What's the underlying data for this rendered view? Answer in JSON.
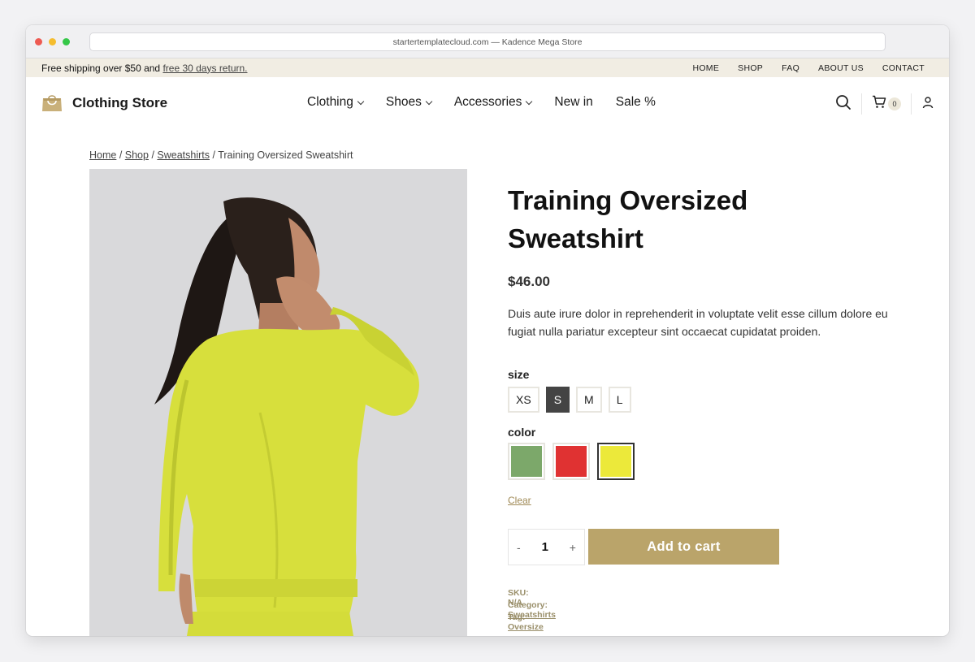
{
  "browser": {
    "url": "startertemplatecloud.com — Kadence Mega Store"
  },
  "topbar": {
    "shipping_text": "Free shipping over $50 and ",
    "shipping_link": "free 30 days return.",
    "nav": [
      "HOME",
      "SHOP",
      "FAQ",
      "ABOUT US",
      "CONTACT"
    ]
  },
  "header": {
    "brand": "Clothing Store",
    "nav": [
      "Clothing",
      "Shoes",
      "Accessories",
      "New in",
      "Sale %"
    ],
    "cart_count": "0"
  },
  "breadcrumb": {
    "home": "Home",
    "shop": "Shop",
    "category": "Sweatshirts",
    "current": "Training Oversized Sweatshirt",
    "sep": " / "
  },
  "product": {
    "title": "Training Oversized Sweatshirt",
    "price": "$46.00",
    "description": "Duis aute irure dolor in reprehenderit in voluptate velit esse cillum dolore eu fugiat nulla pariatur excepteur sint occaecat cupidatat proiden.",
    "size_label": "size",
    "sizes": [
      "XS",
      "S",
      "M",
      "L"
    ],
    "selected_size": "S",
    "color_label": "color",
    "colors": [
      "#7ca86a",
      "#e03232",
      "#ece93a"
    ],
    "selected_color": "#ece93a",
    "clear_label": "Clear",
    "qty_minus": "-",
    "quantity": "1",
    "qty_plus": "+",
    "add_to_cart": "Add to cart",
    "sku_label": "SKU: ",
    "sku": "N/A",
    "category_label": "Category: ",
    "category": "Sweatshirts",
    "tag_label": "Tag: ",
    "tag": "Oversize"
  },
  "colors": {
    "accent": "#baa46a",
    "topbar_bg": "#f1ede3"
  }
}
